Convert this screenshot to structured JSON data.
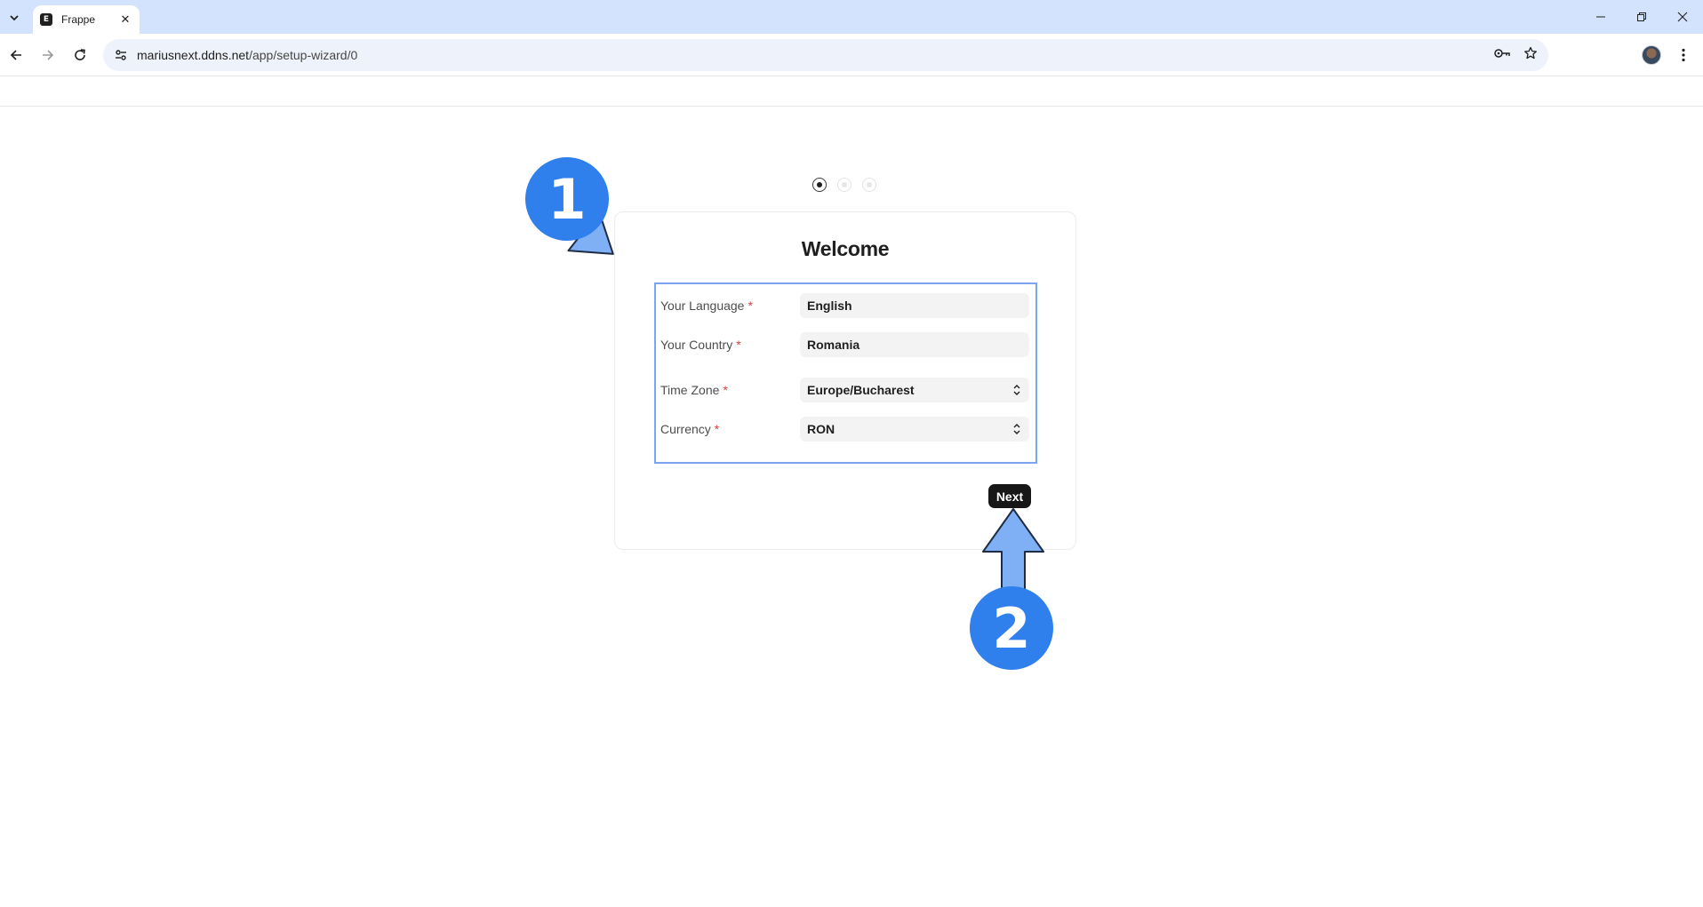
{
  "browser": {
    "tab_title": "Frappe",
    "favicon_letter": "E",
    "url_host": "mariusnext.ddns.net",
    "url_path": "/app/setup-wizard/0"
  },
  "wizard": {
    "step_count": 3,
    "active_step": 1,
    "title": "Welcome",
    "fields": {
      "language": {
        "label": "Your Language",
        "required_mark": "*",
        "value": "English"
      },
      "country": {
        "label": "Your Country",
        "required_mark": "*",
        "value": "Romania"
      },
      "timezone": {
        "label": "Time Zone",
        "required_mark": "*",
        "value": "Europe/Bucharest"
      },
      "currency": {
        "label": "Currency",
        "required_mark": "*",
        "value": "RON"
      }
    },
    "next_label": "Next"
  },
  "annotations": {
    "badge_1": "1",
    "badge_2": "2",
    "color": "#2f80ed",
    "arrow_fill": "#7fb0f6"
  }
}
